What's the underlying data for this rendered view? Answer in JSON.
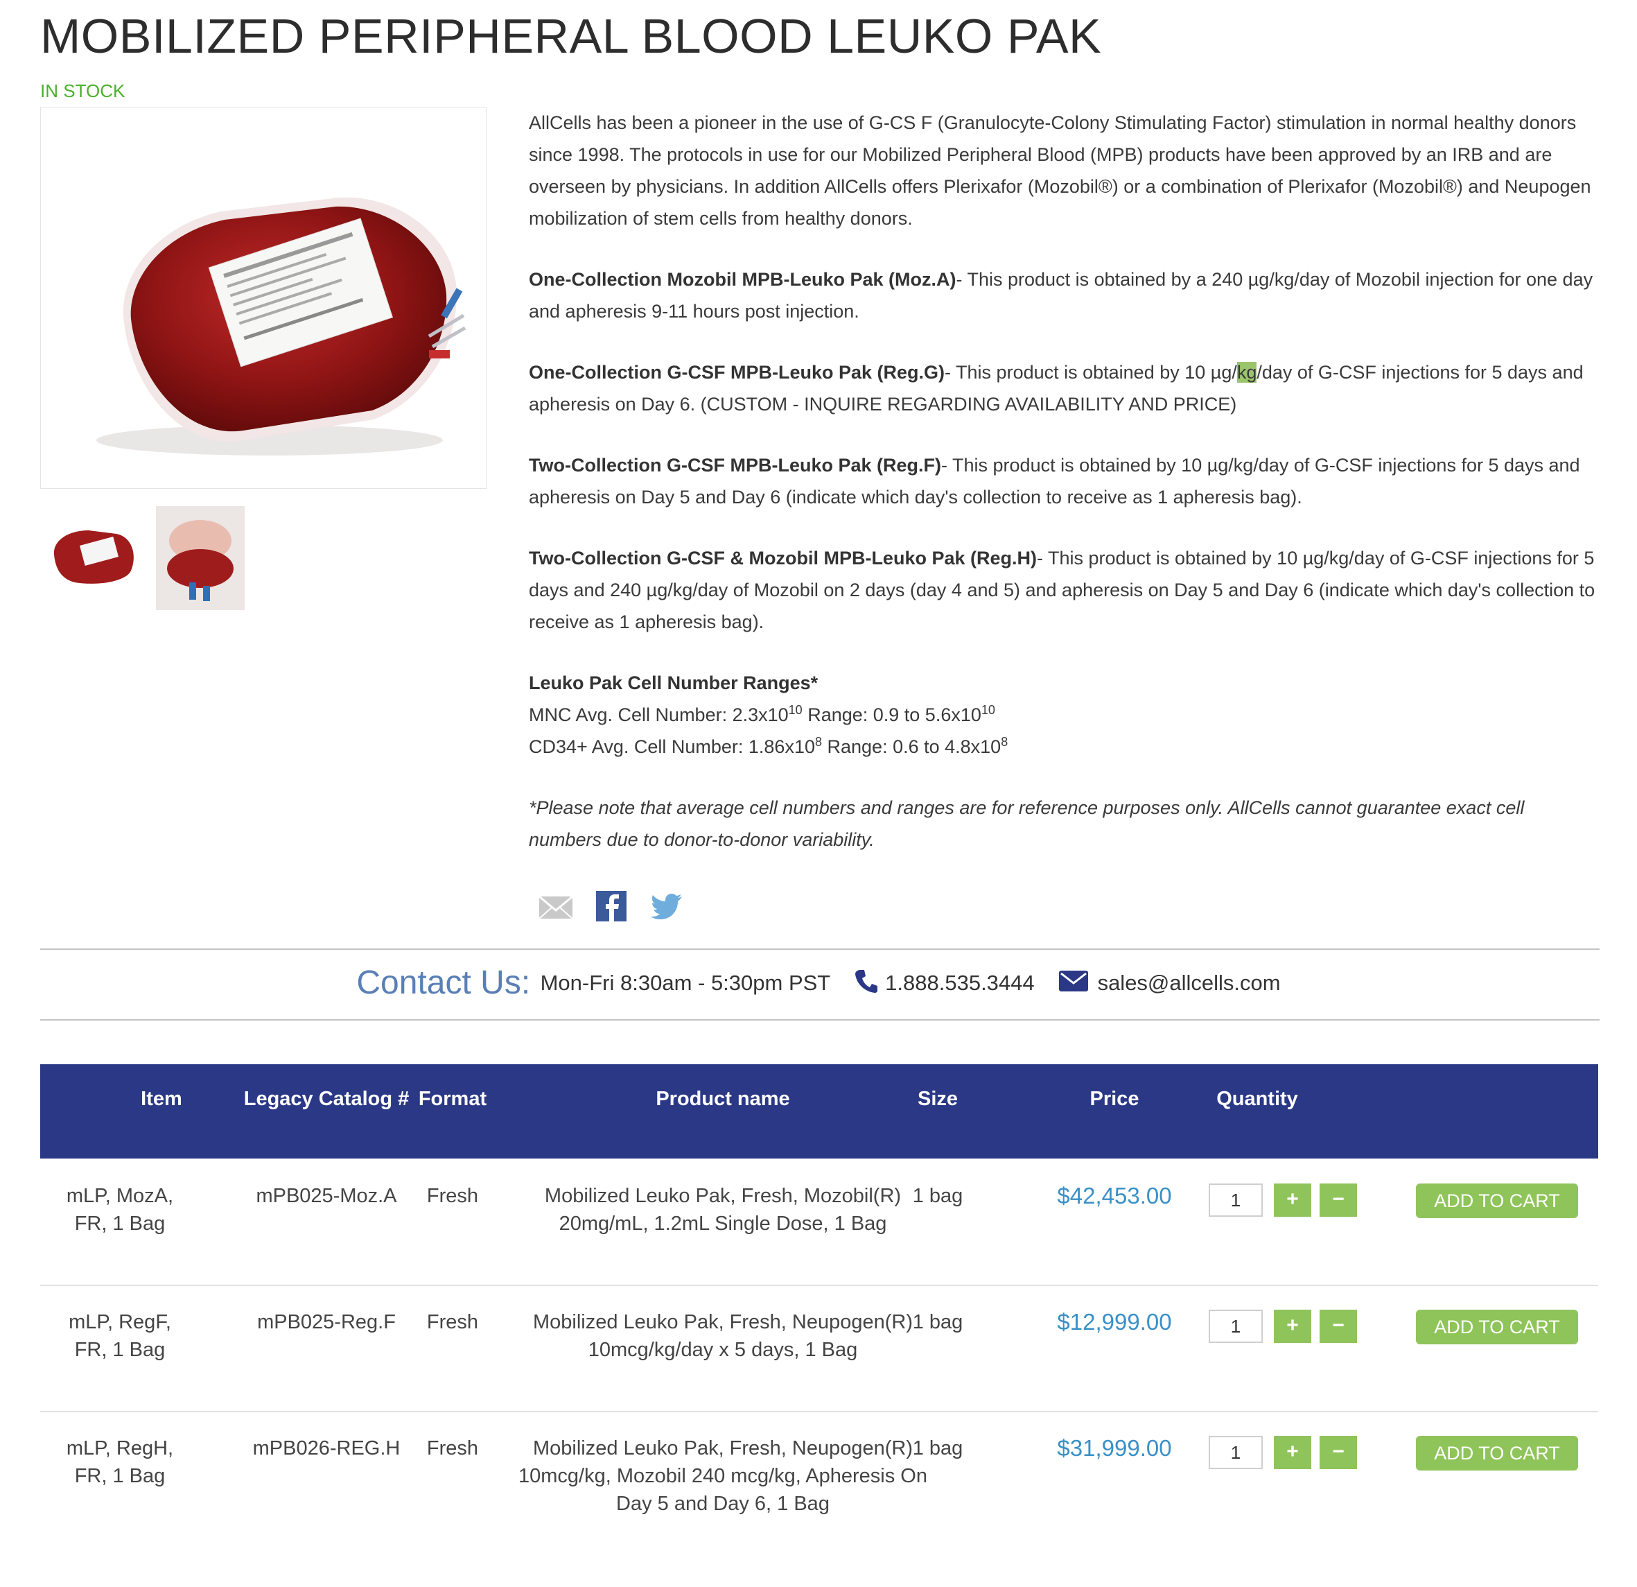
{
  "product": {
    "title": "MOBILIZED PERIPHERAL BLOOD LEUKO PAK",
    "stock_status": "IN STOCK"
  },
  "description": {
    "intro": "AllCells has been a pioneer in the use of G-CS F (Granulocyte-Colony Stimulating Factor) stimulation in normal healthy donors since 1998. The protocols in use for our Mobilized Peripheral Blood (MPB) products have been approved by an IRB and are overseen by physicians. In addition AllCells offers Plerixafor (Mozobil®) or a combination of Plerixafor (Mozobil®) and Neupogen mobilization of stem cells from healthy donors.",
    "products": [
      {
        "name": "One-Collection Mozobil MPB-Leuko Pak (Moz.A)",
        "text": "- This product is obtained by a 240 µg/kg/day of Mozobil injection for one day and apheresis 9-11 hours post injection."
      },
      {
        "name": "One-Collection G-CSF MPB-Leuko Pak (Reg.G)",
        "text_pre": "- This product is obtained by 10 µg/",
        "highlight": "kg",
        "text_post": "/day of G-CSF injections for 5 days and apheresis on Day 6. (CUSTOM - INQUIRE REGARDING AVAILABILITY AND PRICE)"
      },
      {
        "name": "Two-Collection G-CSF MPB-Leuko Pak (Reg.F)",
        "text": "- This product is obtained by 10 µg/kg/day of G-CSF injections for 5 days and apheresis on Day 5 and Day 6 (indicate which day's collection to receive as 1 apheresis bag)."
      },
      {
        "name": "Two-Collection G-CSF & Mozobil MPB-Leuko Pak (Reg.H)",
        "text": "- This product is obtained by 10 µg/kg/day of G-CSF injections for 5 days and 240 µg/kg/day of Mozobil on 2 days (day 4 and 5) and apheresis on Day 5 and Day 6 (indicate which day's collection to receive as 1 apheresis bag)."
      }
    ],
    "ranges_title": "Leuko Pak Cell Number Ranges*",
    "mnc": {
      "avg_label": "MNC Avg. Cell Number: 2.3x10",
      "avg_exp": "10",
      "range_label": " Range: 0.9 to 5.6x10",
      "range_exp": "10"
    },
    "cd34": {
      "avg_label": "CD34+ Avg. Cell Number: 1.86x10",
      "avg_exp": "8",
      "range_label": " Range: 0.6 to 4.8x10",
      "range_exp": "8"
    },
    "note": "*Please note that average cell numbers and ranges are for reference purposes only. AllCells cannot guarantee exact cell numbers due to donor-to-donor variability."
  },
  "share": {
    "icons": [
      "email-icon",
      "facebook-icon",
      "twitter-icon"
    ]
  },
  "contact": {
    "label": "Contact Us:",
    "hours": "Mon-Fri 8:30am - 5:30pm PST",
    "phone": "1.888.535.3444",
    "email": "sales@allcells.com"
  },
  "table": {
    "headers": [
      "Item",
      "Legacy Catalog #",
      "Format",
      "Product name",
      "Size",
      "Price",
      "Quantity"
    ],
    "rows": [
      {
        "item": "mLP, MozA, FR, 1 Bag",
        "legacy": "mPB025-Moz.A",
        "format": "Fresh",
        "name": "Mobilized Leuko Pak, Fresh, Mozobil(R) 20mg/mL, 1.2mL Single Dose, 1 Bag",
        "size": "1 bag",
        "price": "$42,453.00",
        "qty": "1"
      },
      {
        "item": "mLP, RegF, FR, 1 Bag",
        "legacy": "mPB025-Reg.F",
        "format": "Fresh",
        "name": "Mobilized Leuko Pak, Fresh, Neupogen(R) 10mcg/kg/day x 5 days, 1 Bag",
        "size": "1 bag",
        "price": "$12,999.00",
        "qty": "1"
      },
      {
        "item": "mLP, RegH, FR, 1 Bag",
        "legacy": "mPB026-REG.H",
        "format": "Fresh",
        "name": "Mobilized Leuko Pak, Fresh, Neupogen(R) 10mcg/kg, Mozobil 240 mcg/kg, Apheresis On Day 5 and Day 6, 1 Bag",
        "size": "1 bag",
        "price": "$31,999.00",
        "qty": "1"
      }
    ],
    "plus_label": "+",
    "minus_label": "−",
    "cart_label": "ADD TO CART"
  },
  "colors": {
    "stock": "#4bb02c",
    "table_header": "#2b3886",
    "price": "#3990c7",
    "button": "#8fc45a",
    "contact_label": "#5a7fb6"
  }
}
